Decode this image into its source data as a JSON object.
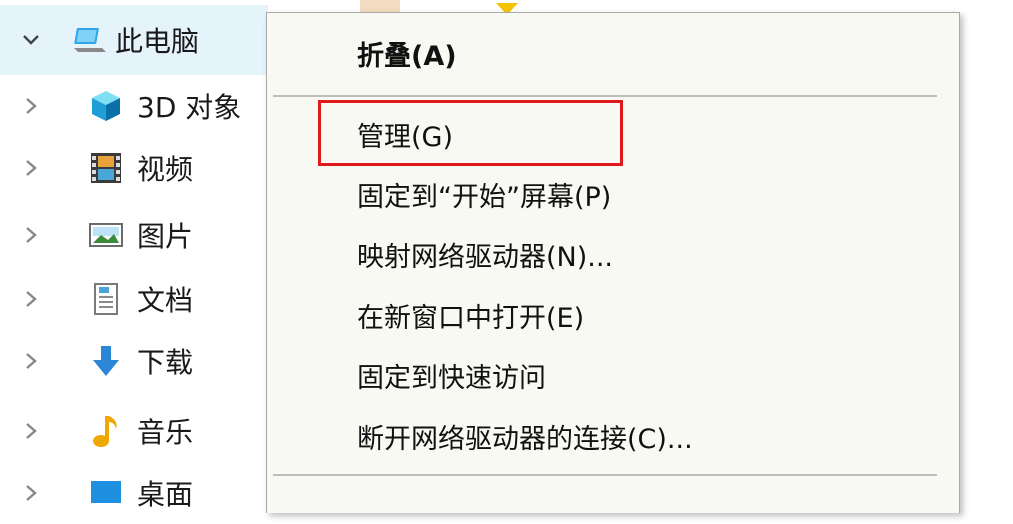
{
  "nav": {
    "items": [
      {
        "label": "此电脑",
        "icon": "computer-icon",
        "expanded": true,
        "selected": true
      },
      {
        "label": "3D 对象",
        "icon": "3d-objects-icon",
        "expanded": false
      },
      {
        "label": "视频",
        "icon": "videos-icon",
        "expanded": false
      },
      {
        "label": "图片",
        "icon": "pictures-icon",
        "expanded": false
      },
      {
        "label": "文档",
        "icon": "documents-icon",
        "expanded": false
      },
      {
        "label": "下载",
        "icon": "downloads-icon",
        "expanded": false
      },
      {
        "label": "音乐",
        "icon": "music-icon",
        "expanded": false
      },
      {
        "label": "桌面",
        "icon": "desktop-icon",
        "expanded": false
      }
    ]
  },
  "context_menu": {
    "items": [
      {
        "label": "折叠(A)",
        "bold": true
      },
      {
        "label": "管理(G)",
        "highlighted": true
      },
      {
        "label": "固定到“开始”屏幕(P)"
      },
      {
        "label": "映射网络驱动器(N)..."
      },
      {
        "label": "在新窗口中打开(E)"
      },
      {
        "label": "固定到快速访问"
      },
      {
        "label": "断开网络驱动器的连接(C)..."
      }
    ]
  },
  "colors": {
    "selection_bg": "#e5f3fb",
    "menu_bg": "#f9f9f4",
    "highlight_border": "#e0191c"
  }
}
